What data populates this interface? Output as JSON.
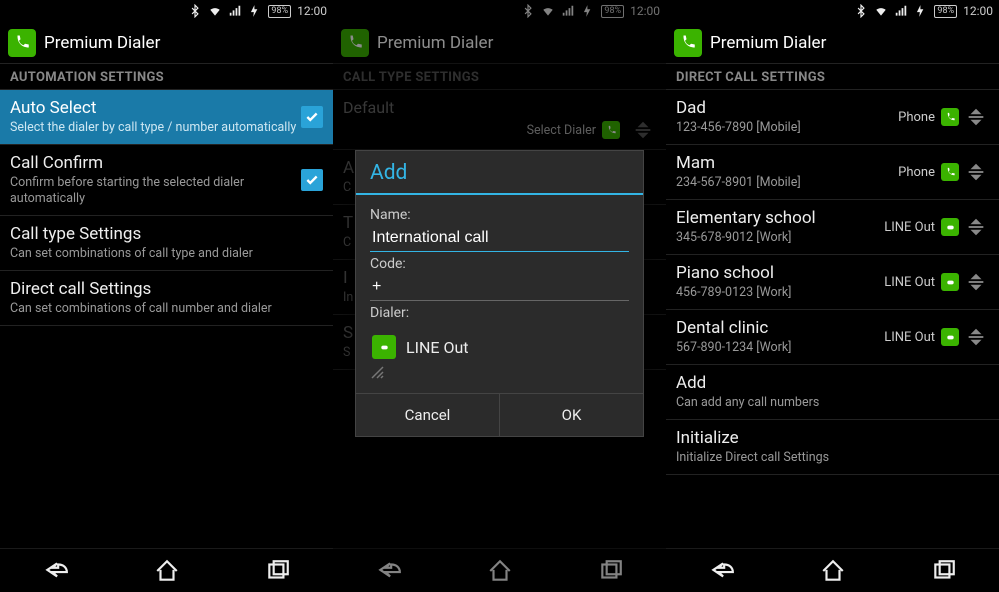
{
  "status": {
    "battery": "98%",
    "time": "12:00"
  },
  "app": {
    "title": "Premium Dialer"
  },
  "screen1": {
    "section": "AUTOMATION SETTINGS",
    "items": [
      {
        "title": "Auto Select",
        "sub": "Select the dialer by call type / number automatically"
      },
      {
        "title": "Call Confirm",
        "sub": "Confirm before starting the selected dialer automatically"
      },
      {
        "title": "Call type Settings",
        "sub": "Can set combinations of call type and dialer"
      },
      {
        "title": "Direct call Settings",
        "sub": "Can set combinations of call number and dialer"
      }
    ]
  },
  "screen2": {
    "section": "CALL TYPE SETTINGS",
    "bg_items": [
      {
        "title": "Default",
        "right_label": "Select Dialer"
      },
      {
        "title": "A",
        "sub": "C"
      },
      {
        "title": "T",
        "sub": "C"
      },
      {
        "title": "I",
        "sub": "In"
      },
      {
        "title": "S",
        "sub": "S"
      }
    ],
    "dialog": {
      "title": "Add",
      "name_label": "Name:",
      "name_value": "International call",
      "code_label": "Code:",
      "code_value": "+",
      "dialer_label": "Dialer:",
      "dialer_value": "LINE Out",
      "cancel": "Cancel",
      "ok": "OK"
    }
  },
  "screen3": {
    "section": "DIRECT CALL SETTINGS",
    "contacts": [
      {
        "name": "Dad",
        "num": "123-456-7890 [Mobile]",
        "dialer": "Phone",
        "icon": "phone"
      },
      {
        "name": "Mam",
        "num": "234-567-8901 [Mobile]",
        "dialer": "Phone",
        "icon": "phone"
      },
      {
        "name": "Elementary school",
        "num": "345-678-9012 [Work]",
        "dialer": "LINE Out",
        "icon": "line"
      },
      {
        "name": "Piano school",
        "num": "456-789-0123 [Work]",
        "dialer": "LINE Out",
        "icon": "line"
      },
      {
        "name": "Dental clinic",
        "num": "567-890-1234 [Work]",
        "dialer": "LINE Out",
        "icon": "line"
      }
    ],
    "extra": [
      {
        "title": "Add",
        "sub": "Can add any call numbers"
      },
      {
        "title": "Initialize",
        "sub": "Initialize Direct call Settings"
      }
    ]
  }
}
